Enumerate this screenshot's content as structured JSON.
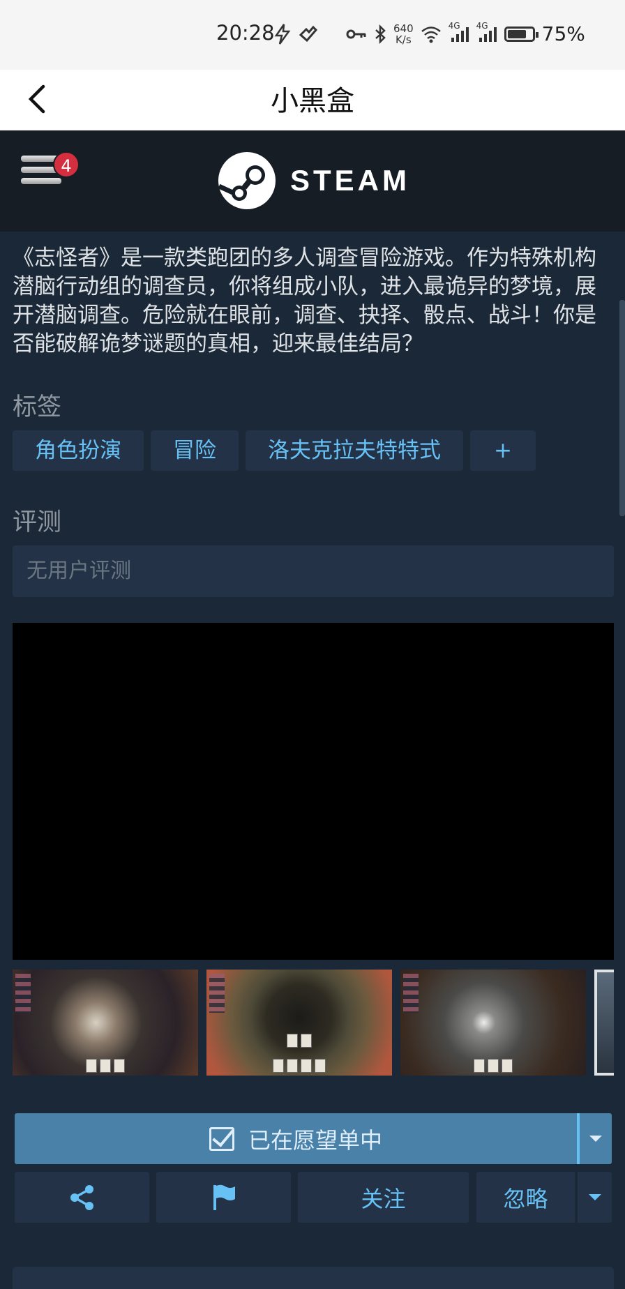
{
  "status_bar": {
    "time": "20:28",
    "net_speed_value": "640",
    "net_speed_unit": "K/s",
    "signal_1": "4G",
    "signal_2": "4G",
    "battery_percent": "75%",
    "battery_level": 0.75,
    "icons": [
      "charging-bolt-icon",
      "heartbeat-icon",
      "key-icon",
      "bluetooth-icon",
      "wifi-icon",
      "signal-icon",
      "battery-icon"
    ]
  },
  "app_bar": {
    "title": "小黑盒",
    "back_icon": "chevron-left-icon"
  },
  "steam_header": {
    "menu_badge_count": "4",
    "logo_text": "STEAM",
    "colors": {
      "background": "#171d25",
      "badge": "#d32f3f"
    }
  },
  "game": {
    "description": "《志怪者》是一款类跑团的多人调查冒险游戏。作为特殊机构潜脑行动组的调查员，你将组成小队，进入最诡异的梦境，展开潜脑调查。危险就在眼前，调查、抉择、骰点、战斗！你是否能破解诡梦谜题的真相，迎来最佳结局？",
    "tags_label": "标签",
    "tags": [
      "角色扮演",
      "冒险",
      "洛夫克拉夫特特式",
      "+"
    ],
    "reviews_label": "评测",
    "reviews_value": "无用户评测"
  },
  "actions": {
    "wishlist_label": "已在愿望单中",
    "follow_label": "关注",
    "ignore_label": "忽略",
    "share_icon": "share-icon",
    "flag_icon": "flag-icon"
  },
  "colors": {
    "page_background": "#1b2838",
    "accent_blue": "#67c1f5",
    "wishlist_button": "#4a81a8",
    "panel": "#233246"
  }
}
